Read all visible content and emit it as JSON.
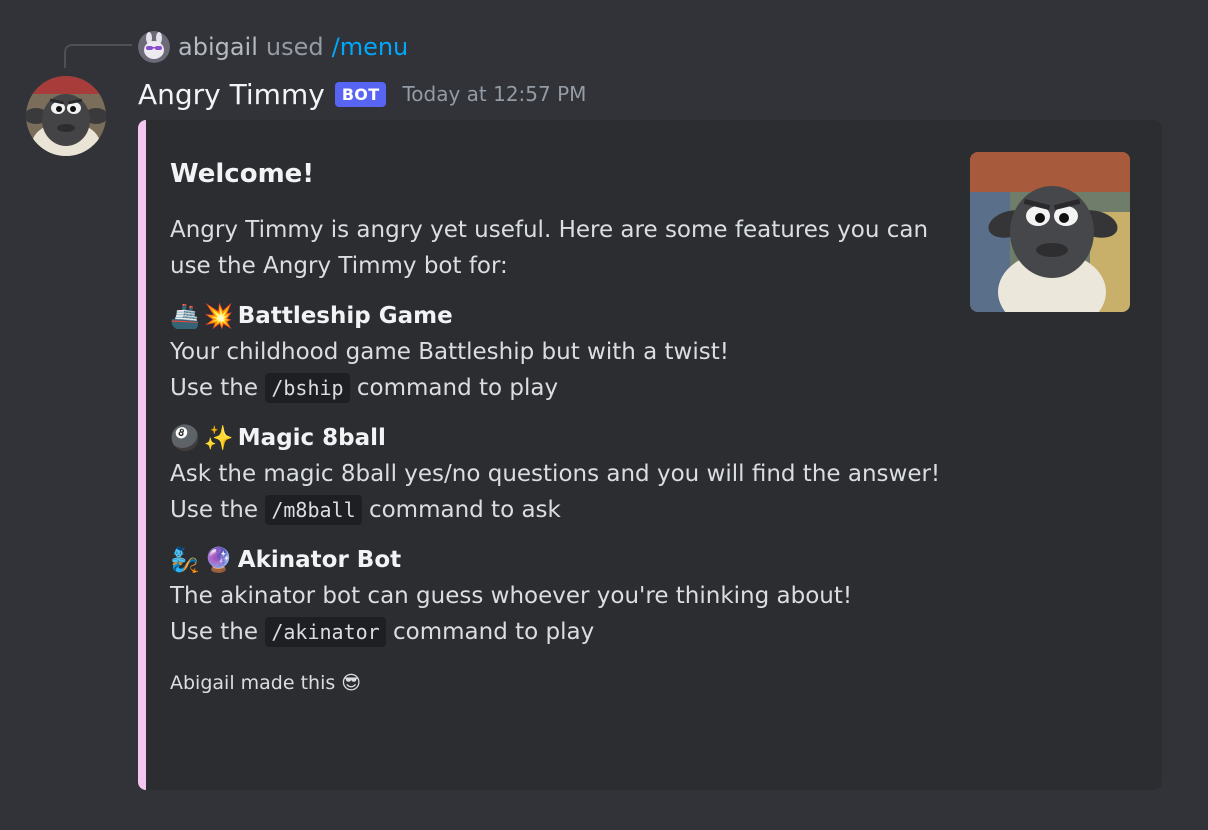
{
  "reply": {
    "username": "abigail",
    "used_text": "used",
    "command": "/menu"
  },
  "message": {
    "author": "Angry Timmy",
    "bot_tag": "BOT",
    "timestamp": "Today at 12:57 PM"
  },
  "embed": {
    "accent_color": "#f5c5f2",
    "title": "Welcome!",
    "description": "Angry Timmy is angry yet useful. Here are some features you can use the Angry Timmy bot for:",
    "fields": [
      {
        "emoji1": "🚢",
        "emoji2": "💥",
        "name": "Battleship Game",
        "line1": "Your childhood game Battleship but with a twist!",
        "use_prefix": "Use the",
        "command": "/bship",
        "use_suffix": "command to play"
      },
      {
        "emoji1": "🎱",
        "emoji2": "✨",
        "name": "Magic 8ball",
        "line1": "Ask the magic 8ball yes/no questions and you will find the answer!",
        "use_prefix": "Use the",
        "command": "/m8ball",
        "use_suffix": "command to ask"
      },
      {
        "emoji1": "🧞",
        "emoji2": "🔮",
        "name": "Akinator Bot",
        "line1": "The akinator bot can guess whoever you're thinking about!",
        "use_prefix": "Use the",
        "command": "/akinator",
        "use_suffix": "command to play"
      }
    ],
    "footer": "Abigail made this 😎"
  },
  "icons": {
    "avatar": "sheep-avatar-icon",
    "thumbnail": "sheep-thumbnail-icon",
    "mini_avatar": "bunny-avatar-icon"
  }
}
